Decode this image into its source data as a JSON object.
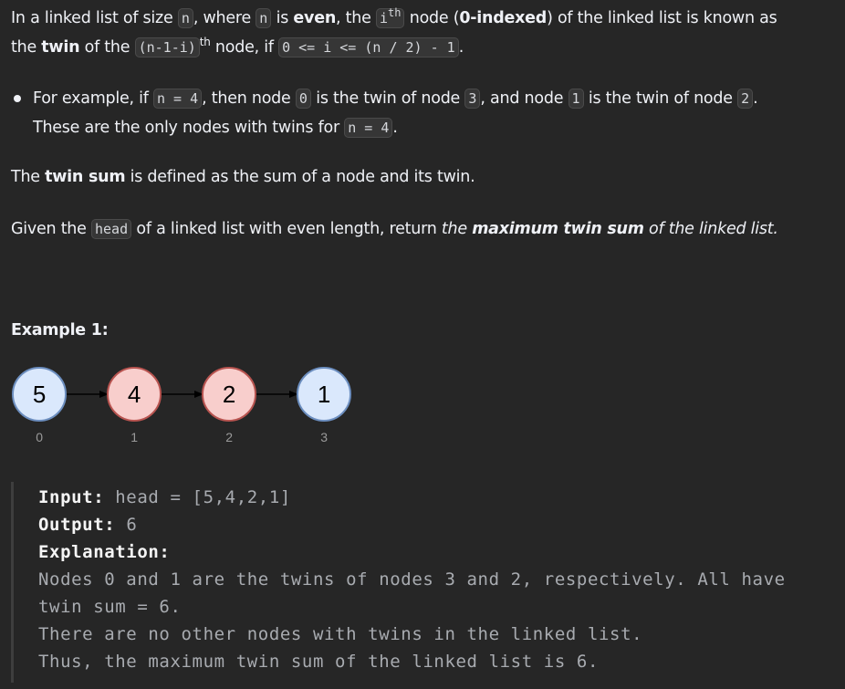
{
  "intro": {
    "l1_a": "In a linked list of size ",
    "l1_n1": "n",
    "l1_b": ", where ",
    "l1_n2": "n",
    "l1_c": " is ",
    "l1_even": "even",
    "l1_d": ", the ",
    "l1_i": "i",
    "l1_th": "th",
    "l1_e": " node (",
    "l1_zero": "0-indexed",
    "l1_f": ") of the linked list is known as",
    "l2_a": "the ",
    "l2_twin": "twin",
    "l2_b": " of the ",
    "l2_expr": "(n-1-i)",
    "l2_th": "th",
    "l2_c": " node, if ",
    "l2_cond": "0 <= i <= (n / 2) - 1",
    "l2_d": "."
  },
  "bullet": {
    "l1_a": "For example, if ",
    "l1_code1": "n = 4",
    "l1_b": ", then node ",
    "l1_code2": "0",
    "l1_c": " is the twin of node ",
    "l1_code3": "3",
    "l1_d": ", and node ",
    "l1_code4": "1",
    "l1_e": " is the twin of node ",
    "l1_code5": "2",
    "l1_f": ".",
    "l2_a": "These are the only nodes with twins for ",
    "l2_code": "n = 4",
    "l2_b": "."
  },
  "twin_def": {
    "a": "The ",
    "bold": "twin sum",
    "b": " is defined as the sum of a node and its twin."
  },
  "task": {
    "a": "Given the ",
    "code": "head",
    "b": " of a linked list with even length, return ",
    "it1": "the ",
    "bi": "maximum twin sum",
    "it2": " of the linked list."
  },
  "example_title": "Example 1:",
  "diagram": {
    "nodes": [
      {
        "value": "5",
        "index": "0",
        "fill": "#dae8fc",
        "stroke": "#6c8ebf"
      },
      {
        "value": "4",
        "index": "1",
        "fill": "#f8cecc",
        "stroke": "#b85450"
      },
      {
        "value": "2",
        "index": "2",
        "fill": "#f8cecc",
        "stroke": "#b85450"
      },
      {
        "value": "1",
        "index": "3",
        "fill": "#dae8fc",
        "stroke": "#6c8ebf"
      }
    ]
  },
  "example": {
    "input_label": "Input:",
    "input_value": " head = [5,4,2,1]",
    "output_label": "Output:",
    "output_value": " 6",
    "explanation_label": "Explanation:",
    "lines": [
      "Nodes 0 and 1 are the twins of nodes 3 and 2, respectively. All have",
      "twin sum = 6.",
      "There are no other nodes with twins in the linked list.",
      "Thus, the maximum twin sum of the linked list is 6."
    ]
  }
}
